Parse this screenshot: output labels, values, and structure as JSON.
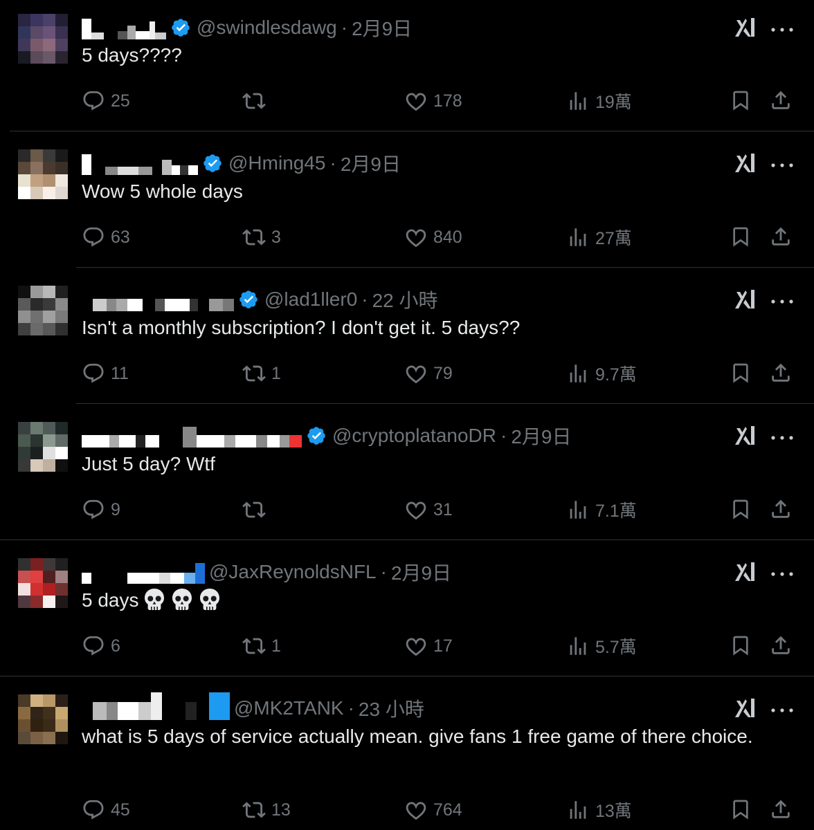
{
  "ui": {
    "accent": "#1d9bf0",
    "text": "#e7e9ea",
    "muted": "#71767b",
    "divider": "#2f3336",
    "background": "#000000"
  },
  "tweets": [
    {
      "handle": "@swindlesdawg",
      "time": "2月9日",
      "verified": true,
      "text": "5 days????",
      "replies": "25",
      "retweets": "",
      "likes": "178",
      "views": "19萬"
    },
    {
      "handle": "@Hming45",
      "time": "2月9日",
      "verified": true,
      "text": "Wow 5 whole days",
      "replies": "63",
      "retweets": "3",
      "likes": "840",
      "views": "27萬"
    },
    {
      "handle": "@lad1ller0",
      "time": "22 小時",
      "verified": true,
      "text": "Isn't a monthly subscription? I don't get it. 5 days??",
      "replies": "11",
      "retweets": "1",
      "likes": "79",
      "views": "9.7萬"
    },
    {
      "handle": "@cryptoplatanoDR",
      "time": "2月9日",
      "verified": true,
      "text": "Just 5 day?  Wtf",
      "replies": "9",
      "retweets": "",
      "likes": "31",
      "views": "7.1萬"
    },
    {
      "handle": "@JaxReynoldsNFL",
      "time": "2月9日",
      "verified": false,
      "text": "5 days",
      "replies": "6",
      "retweets": "1",
      "likes": "17",
      "views": "5.7萬"
    },
    {
      "handle": "@MK2TANK",
      "time": "23 小時",
      "verified": false,
      "text": "what is 5 days of service actually mean.  give fans 1 free game of there choice.",
      "replies": "45",
      "retweets": "13",
      "likes": "764",
      "views": "13萬"
    }
  ],
  "icons": {
    "reply": "reply-icon",
    "retweet": "retweet-icon",
    "like": "like-icon",
    "views": "views-icon",
    "bookmark": "bookmark-icon",
    "share": "share-icon",
    "grok": "grok-icon",
    "more": "more-icon",
    "verified": "verified-badge-icon",
    "emoji": "skull-emoji-icon"
  }
}
